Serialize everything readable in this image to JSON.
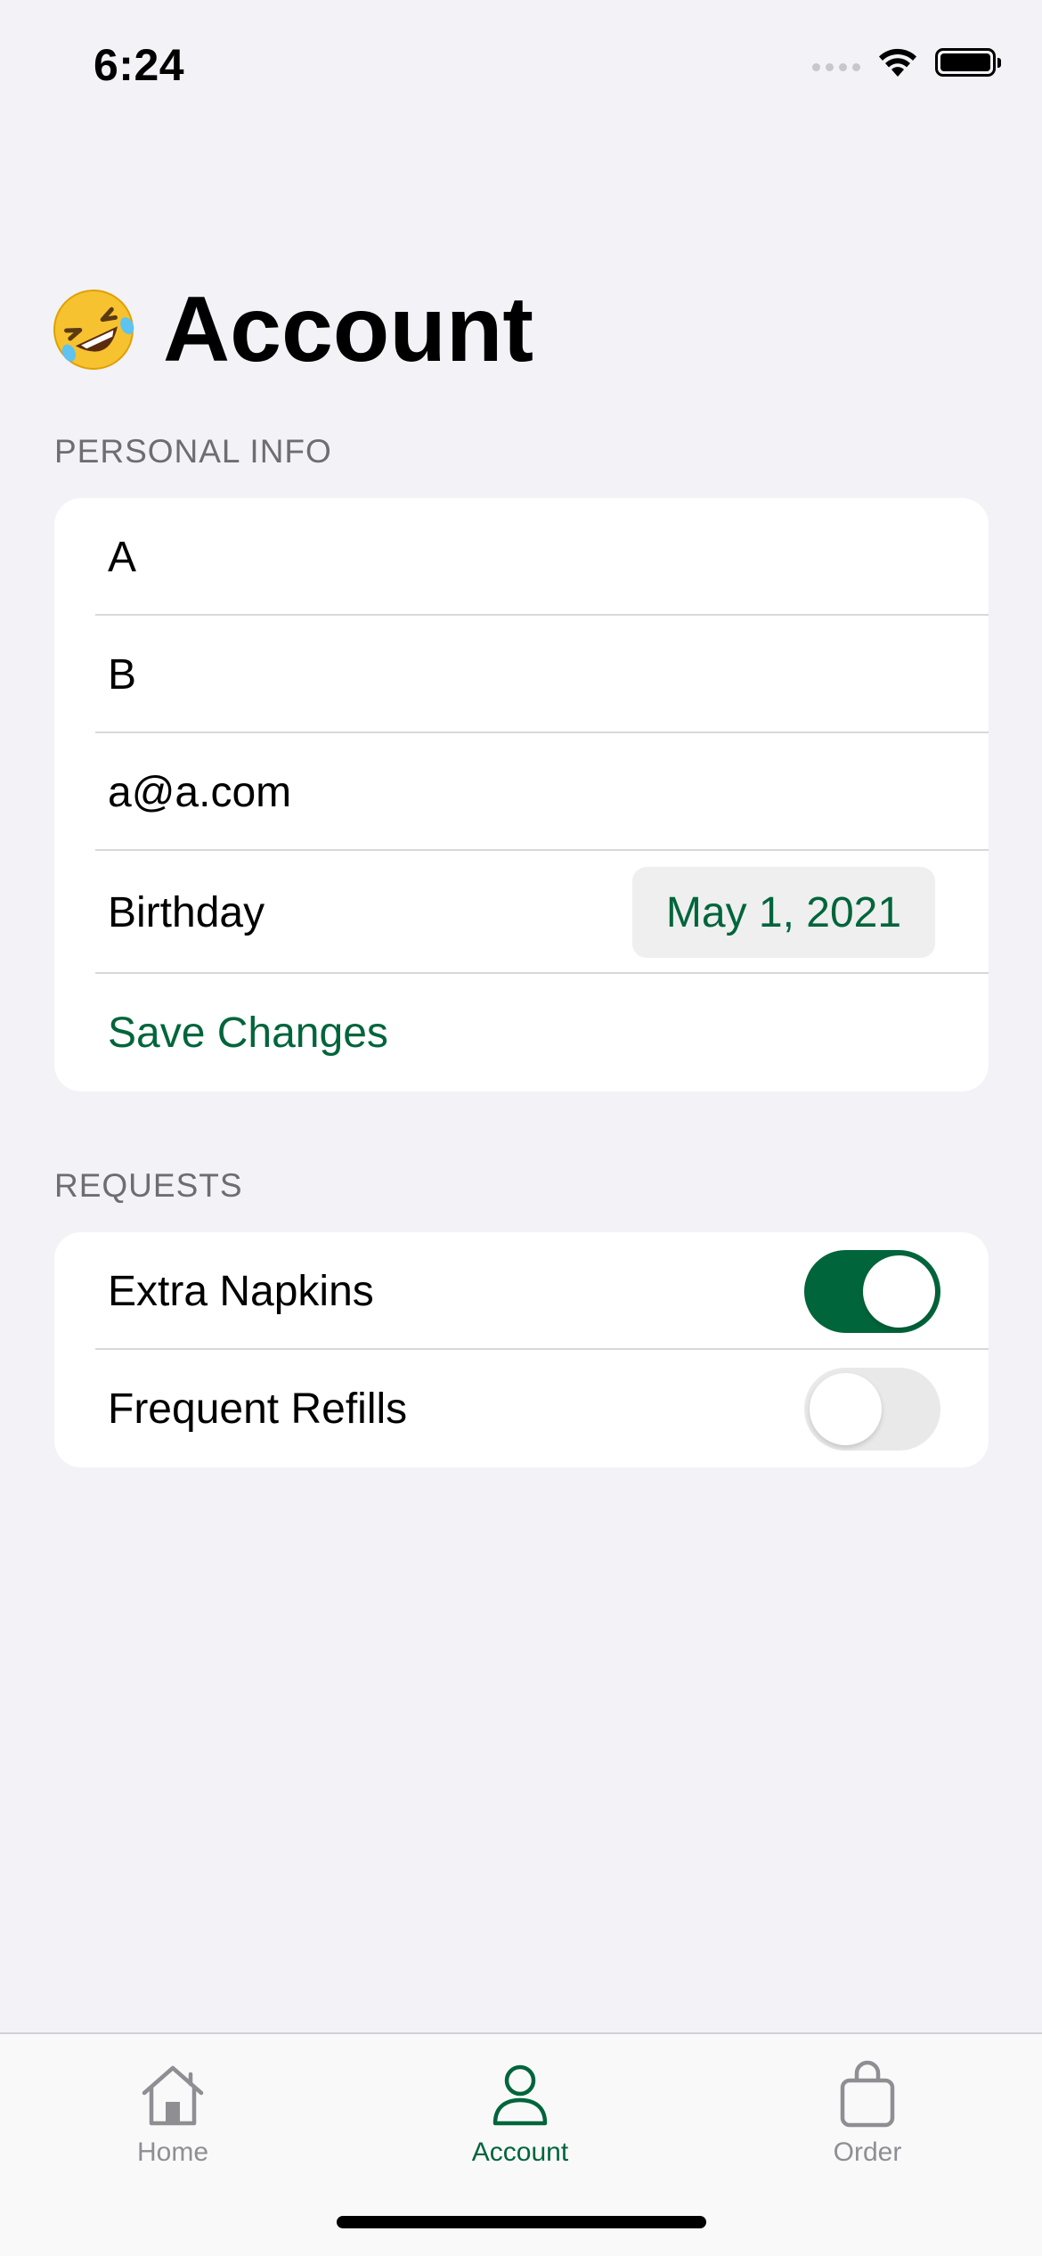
{
  "status_bar": {
    "time": "6:24"
  },
  "header": {
    "emoji": "rolling-on-floor-laughing-emoji",
    "title": "Account"
  },
  "personal_info": {
    "section_title": "PERSONAL INFO",
    "first_name": "A",
    "last_name": "B",
    "email": "a@a.com",
    "birthday_label": "Birthday",
    "birthday_value": "May 1, 2021",
    "save_label": "Save Changes"
  },
  "requests": {
    "section_title": "REQUESTS",
    "items": [
      {
        "label": "Extra Napkins",
        "on": true
      },
      {
        "label": "Frequent Refills",
        "on": false
      }
    ]
  },
  "tab_bar": {
    "tabs": [
      {
        "label": "Home",
        "icon": "house-icon",
        "active": false
      },
      {
        "label": "Account",
        "icon": "person-icon",
        "active": true
      },
      {
        "label": "Order",
        "icon": "bag-icon",
        "active": false
      }
    ]
  },
  "colors": {
    "accent": "#00653b",
    "background": "#f2f2f7",
    "card": "#ffffff",
    "secondary_text": "#6d6d72",
    "inactive_tab": "#8e8e93"
  }
}
